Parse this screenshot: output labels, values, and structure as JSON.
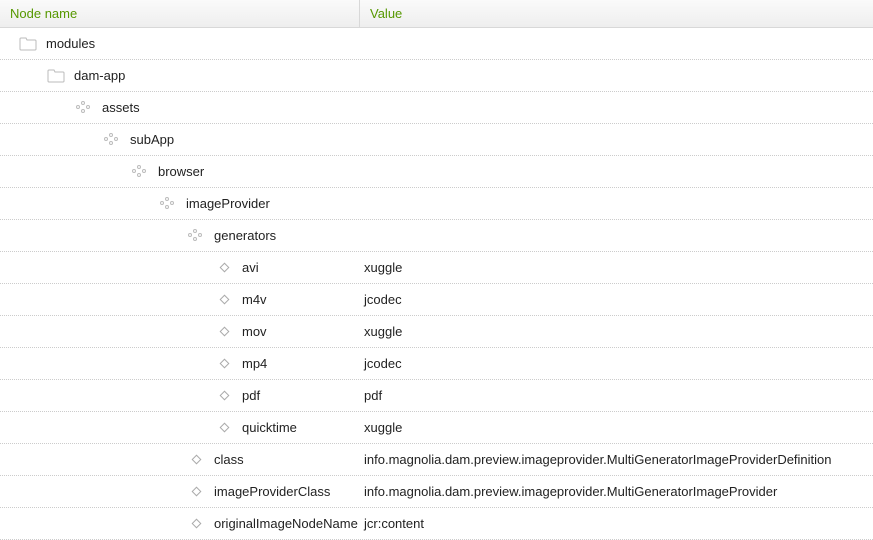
{
  "header": {
    "name_col": "Node name",
    "value_col": "Value"
  },
  "rows": [
    {
      "depth": 0,
      "icon": "folder",
      "name": "modules",
      "value": ""
    },
    {
      "depth": 1,
      "icon": "folder",
      "name": "dam-app",
      "value": ""
    },
    {
      "depth": 2,
      "icon": "dots",
      "name": "assets",
      "value": ""
    },
    {
      "depth": 3,
      "icon": "dots",
      "name": "subApp",
      "value": ""
    },
    {
      "depth": 4,
      "icon": "dots",
      "name": "browser",
      "value": ""
    },
    {
      "depth": 5,
      "icon": "dots",
      "name": "imageProvider",
      "value": ""
    },
    {
      "depth": 6,
      "icon": "dots",
      "name": "generators",
      "value": ""
    },
    {
      "depth": 7,
      "icon": "diamond",
      "name": "avi",
      "value": "xuggle"
    },
    {
      "depth": 7,
      "icon": "diamond",
      "name": "m4v",
      "value": "jcodec"
    },
    {
      "depth": 7,
      "icon": "diamond",
      "name": "mov",
      "value": "xuggle"
    },
    {
      "depth": 7,
      "icon": "diamond",
      "name": "mp4",
      "value": "jcodec"
    },
    {
      "depth": 7,
      "icon": "diamond",
      "name": "pdf",
      "value": "pdf"
    },
    {
      "depth": 7,
      "icon": "diamond",
      "name": "quicktime",
      "value": "xuggle"
    },
    {
      "depth": 6,
      "icon": "diamond",
      "name": "class",
      "value": "info.magnolia.dam.preview.imageprovider.MultiGeneratorImageProviderDefinition"
    },
    {
      "depth": 6,
      "icon": "diamond",
      "name": "imageProviderClass",
      "value": "info.magnolia.dam.preview.imageprovider.MultiGeneratorImageProvider"
    },
    {
      "depth": 6,
      "icon": "diamond",
      "name": "originalImageNodeName",
      "value": "jcr:content"
    }
  ]
}
